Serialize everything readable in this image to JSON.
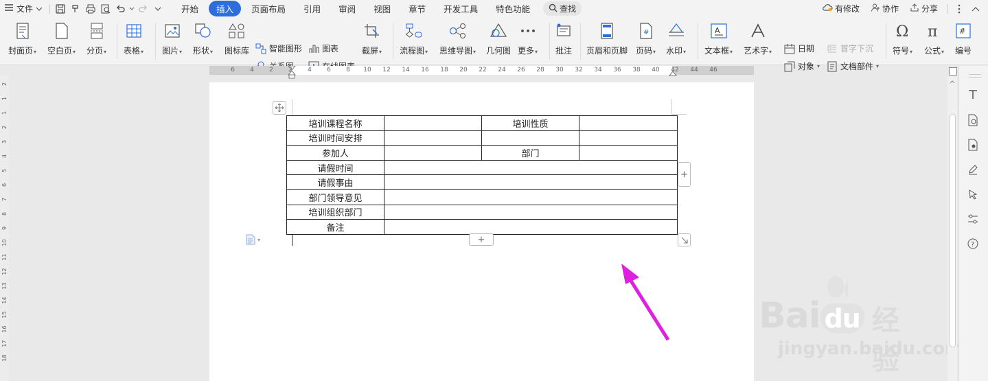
{
  "menubar": {
    "file_label": "文件",
    "tabs": [
      {
        "label": "开始",
        "active": false
      },
      {
        "label": "插入",
        "active": true
      },
      {
        "label": "页面布局",
        "active": false
      },
      {
        "label": "引用",
        "active": false
      },
      {
        "label": "审阅",
        "active": false
      },
      {
        "label": "视图",
        "active": false
      },
      {
        "label": "章节",
        "active": false
      },
      {
        "label": "开发工具",
        "active": false
      },
      {
        "label": "特色功能",
        "active": false
      }
    ],
    "search_label": "查找",
    "modified_label": "有修改",
    "collab_label": "协作",
    "share_label": "分享"
  },
  "ribbon": {
    "cover": "封面页",
    "blank": "空白页",
    "pagebreak": "分页",
    "table": "表格",
    "picture": "图片",
    "shape": "形状",
    "icon_lib": "图标库",
    "smart_shape": "智能图形",
    "chart": "图表",
    "relation": "关系图",
    "online_chart": "在线图表",
    "screenshot": "截屏",
    "flowchart": "流程图",
    "mindmap": "思维导图",
    "geometry": "几何图",
    "more": "更多",
    "comment": "批注",
    "header_footer": "页眉和页脚",
    "page_number": "页码",
    "watermark": "水印",
    "textbox": "文本框",
    "wordart": "艺术字",
    "date": "日期",
    "object": "对象",
    "dropcap": "首字下沉",
    "doc_parts": "文档部件",
    "symbol": "符号",
    "formula": "公式",
    "numbering": "编号"
  },
  "ruler": {
    "h_numbers": [
      "6",
      "4",
      "2",
      "2",
      "4",
      "6",
      "8",
      "10",
      "12",
      "14",
      "16",
      "18",
      "20",
      "22",
      "24",
      "26",
      "28",
      "30",
      "32",
      "34",
      "36",
      "38",
      "40",
      "42",
      "44",
      "46"
    ],
    "v_numbers": [
      "2",
      "1",
      "1",
      "2",
      "3",
      "4",
      "5",
      "6",
      "7",
      "8",
      "9",
      "10",
      "11",
      "12",
      "13",
      "14",
      "15",
      "16",
      "17",
      "18"
    ]
  },
  "table": {
    "rows": [
      [
        "培训课程名称",
        "",
        "培训性质",
        ""
      ],
      [
        "培训时间安排",
        "",
        "",
        ""
      ],
      [
        "参加人",
        "",
        "部门",
        ""
      ],
      [
        "请假时间",
        ""
      ],
      [
        "请假事由",
        ""
      ],
      [
        "部门领导意见",
        ""
      ],
      [
        "培训组织部门",
        ""
      ],
      [
        "备注",
        ""
      ]
    ]
  },
  "watermark": {
    "brand": "Bai",
    "brand2": "du",
    "cn": "经验",
    "url": "jingyan.baidu.com"
  },
  "colors": {
    "accent": "#2c6edb",
    "arrow": "#e020e0"
  }
}
